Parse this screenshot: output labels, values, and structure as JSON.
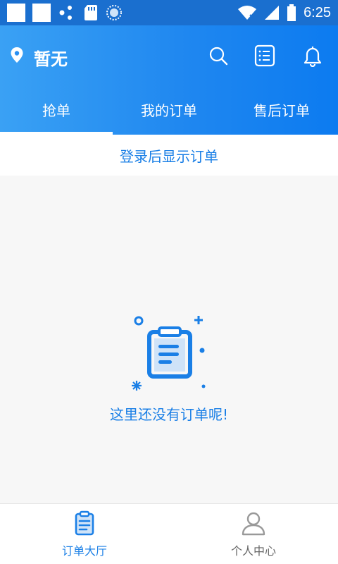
{
  "status_bar": {
    "time": "6:25"
  },
  "header": {
    "location": "暂无",
    "icons": [
      "map-pin-icon",
      "search-icon",
      "list-icon",
      "bell-icon"
    ]
  },
  "tabs": [
    {
      "label": "抢单",
      "active": true
    },
    {
      "label": "我的订单",
      "active": false
    },
    {
      "label": "售后订单",
      "active": false
    }
  ],
  "login_hint": "登录后显示订单",
  "empty_state": {
    "message": "这里还没有订单呢!"
  },
  "bottom_nav": [
    {
      "label": "订单大厅",
      "icon": "clipboard-icon",
      "active": true
    },
    {
      "label": "个人中心",
      "icon": "person-icon",
      "active": false
    }
  ],
  "colors": {
    "accent": "#1a7fe6",
    "header_start": "#3aa1f4",
    "header_end": "#0c7bf0",
    "statusbar": "#1a6fcf"
  }
}
